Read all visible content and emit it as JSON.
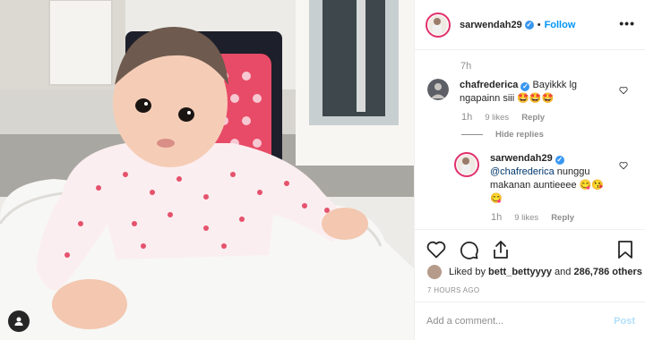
{
  "post": {
    "username": "sarwendah29",
    "follow_label": "Follow",
    "separator": "•",
    "more_label": "•••",
    "caption_time": "7h"
  },
  "comments": [
    {
      "username": "chafrederica",
      "text": "Bayikkk lg ngapainn siii",
      "emoji": "🤩🤩🤩",
      "time": "1h",
      "likes": "9 likes",
      "reply_label": "Reply"
    },
    {
      "username": "sarwendah29",
      "mention": "@chafrederica",
      "text": "nunggu makanan auntieeee",
      "emoji": "😋😘😋",
      "time": "1h",
      "likes": "9 likes",
      "reply_label": "Reply"
    }
  ],
  "hide_replies_label": "Hide replies",
  "liked_by": {
    "prefix": "Liked by",
    "user": "bett_bettyyyy",
    "and": "and",
    "others": "286,786 others"
  },
  "posted_ago": "7 HOURS AGO",
  "add_comment": {
    "placeholder": "Add a comment...",
    "post_label": "Post"
  },
  "colors": {
    "accent": "#0095f6",
    "verified": "#3897f0",
    "muted": "#8e8e8e",
    "post_disabled": "#b2dffc"
  },
  "icons": [
    "user-tag-icon",
    "verified-badge-icon",
    "more-options-icon",
    "heart-icon",
    "comment-icon",
    "share-icon",
    "bookmark-icon"
  ]
}
